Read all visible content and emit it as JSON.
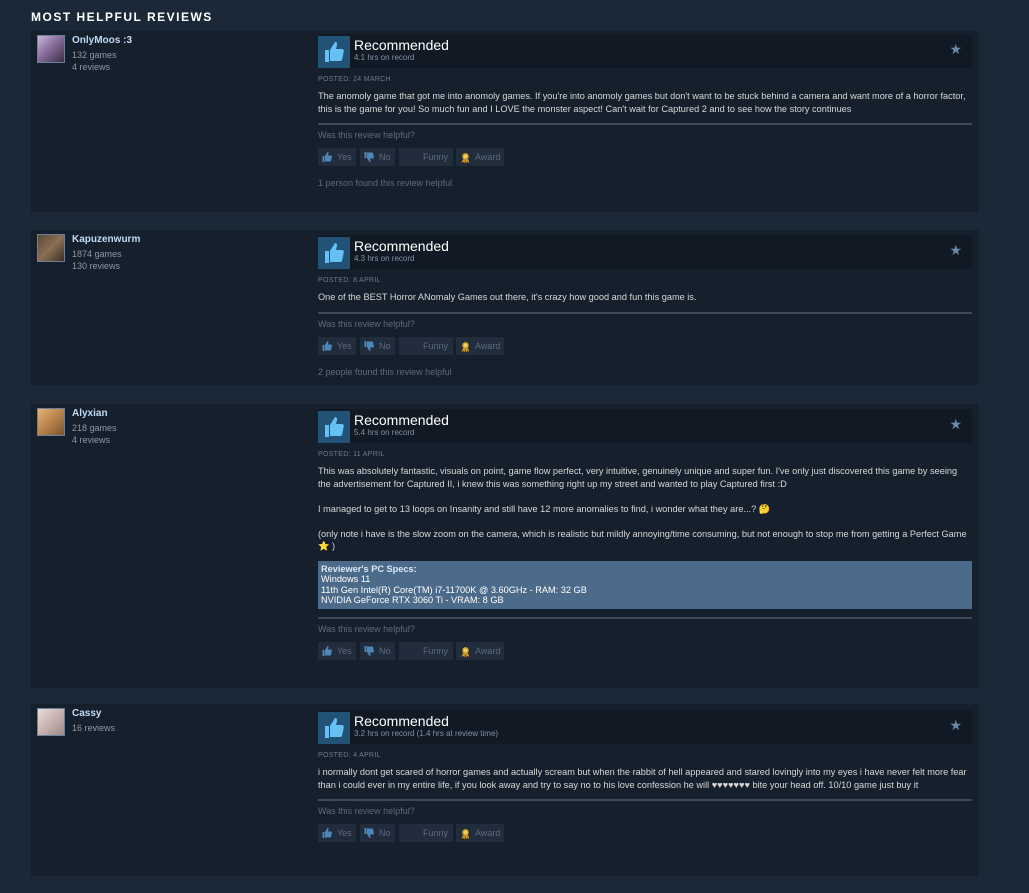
{
  "section_title": "MOST HELPFUL REVIEWS",
  "helpful_prompt": "Was this review helpful?",
  "buttons": {
    "yes": "Yes",
    "no": "No",
    "funny": "Funny",
    "award": "Award"
  },
  "reviews": [
    {
      "author": "OnlyMoos :3",
      "games": "132 games",
      "reviews": "4 reviews",
      "verdict": "Recommended",
      "hours": "4.1 hrs on record",
      "posted": "POSTED: 24 MARCH",
      "paragraphs": [
        "The anomoly game that got me into anomoly games. If you're into anomoly games but don't want to be stuck behind a camera and want more of a horror factor, this is the game for you! So much fun and I LOVE the monster aspect! Can't wait for Captured 2 and to see how the story continues"
      ],
      "found_helpful": "1 person found this review helpful"
    },
    {
      "author": "Kapuzenwurm",
      "games": "1874 games",
      "reviews": "130 reviews",
      "verdict": "Recommended",
      "hours": "4.3 hrs on record",
      "posted": "POSTED: 8 APRIL",
      "paragraphs": [
        "One of the BEST Horror ANomaly Games out there, it's crazy how good and fun this game is."
      ],
      "found_helpful": "2 people found this review helpful"
    },
    {
      "author": "Alyxian",
      "games": "218 games",
      "reviews": "4 reviews",
      "verdict": "Recommended",
      "hours": "5.4 hrs on record",
      "posted": "POSTED: 11 APRIL",
      "paragraphs": [
        "This was absolutely fantastic, visuals on point, game flow perfect, very intuitive, genuinely unique and super fun. I've only just discovered this game by seeing the advertisement for Captured II, i knew this was something right up my street and wanted to play Captured first :D",
        "I managed to get to 13 loops on Insanity and still have 12 more anomalies to find, i wonder what they are...? 🤔",
        "(only note i have is the slow zoom on the camera, which is realistic but mildly annoying/time consuming, but not enough to stop me from getting a Perfect Game ⭐ )"
      ],
      "specs": {
        "heading": "Reviewer's PC Specs:",
        "lines": [
          "Windows 11",
          "11th Gen Intel(R) Core(TM) i7-11700K @ 3.60GHz - RAM: 32 GB",
          "NVIDIA GeForce RTX 3060 Ti - VRAM: 8 GB"
        ]
      }
    },
    {
      "author": "Cassy",
      "reviews": "16 reviews",
      "verdict": "Recommended",
      "hours": "3.2 hrs on record (1.4 hrs at review time)",
      "posted": "POSTED: 4 APRIL",
      "paragraphs": [
        "i normally dont get scared of horror games and actually scream but when the rabbit of hell appeared and stared lovingly into my eyes i have never felt more fear than i could ever in my entire life, if you look away and try to say no to his love confession he will ♥♥♥♥♥♥♥ bite your head off. 10/10 game just buy it"
      ]
    }
  ]
}
